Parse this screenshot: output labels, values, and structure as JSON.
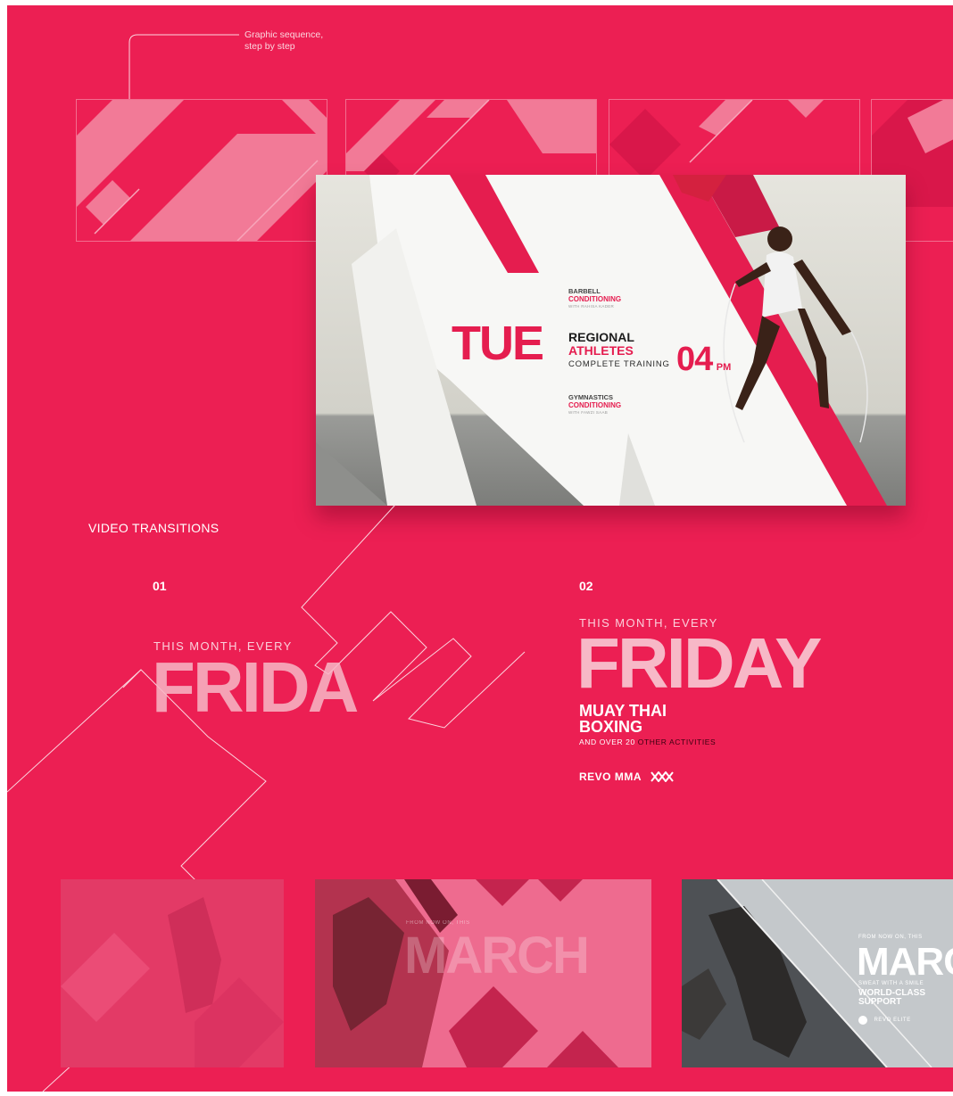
{
  "annotation": {
    "line1": "Graphic sequence,",
    "line2": "step by step"
  },
  "schedule_card": {
    "day": "TUE",
    "top_class": {
      "title": "BARBELL",
      "subtitle": "CONDITIONING",
      "with": "WITH RAHISA KADER"
    },
    "main_class": {
      "line1": "REGIONAL",
      "line2": "ATHLETES",
      "line3": "COMPLETE TRAINING"
    },
    "bottom_class": {
      "title": "GYMNASTICS",
      "subtitle": "CONDITIONING",
      "with": "WITH FAWZI SAAB"
    },
    "time": "04",
    "meridiem": "PM"
  },
  "section_title": "VIDEO TRANSITIONS",
  "transition_01": {
    "number": "01",
    "eyebrow": "THIS MONTH, EVERY",
    "headline": "FRIDA"
  },
  "transition_02": {
    "number": "02",
    "eyebrow": "THIS MONTH, EVERY",
    "headline": "FRIDAY",
    "sub1": "MUAY THAI",
    "sub2": "BOXING",
    "small_prefix": "AND OVER 20",
    "small_highlight": "OTHER ACTIVITIES",
    "brand": "REVO MMA"
  },
  "thumb_2": {
    "eyebrow": "FROM NOW ON, THIS",
    "headline": "MARCH"
  },
  "thumb_3": {
    "eyebrow": "FROM NOW ON, THIS",
    "headline": "MARC",
    "tagline": "SWEAT WITH A SMILE",
    "sub1": "WORLD-CLASS",
    "sub2": "SUPPORT",
    "brand": "REVO ELITE"
  },
  "colors": {
    "background": "#ec1f53",
    "accent": "#e51d4f",
    "pale_pink": "#f7b8c7"
  }
}
